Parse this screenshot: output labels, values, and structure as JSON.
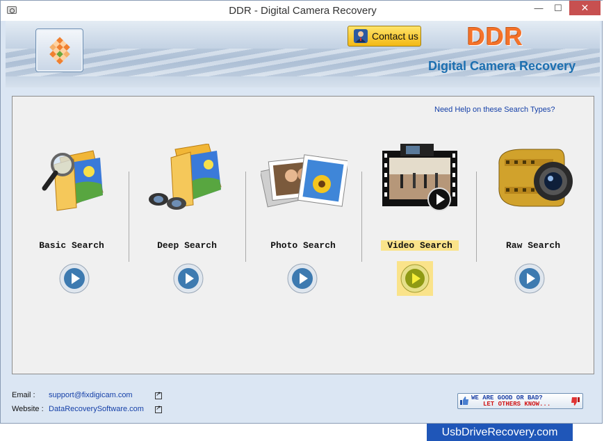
{
  "window": {
    "title": "DDR - Digital Camera Recovery",
    "minimize": "—",
    "maximize": "☐",
    "close": "✕"
  },
  "header": {
    "contact_label": "Contact us",
    "brand": "DDR",
    "subtitle": "Digital Camera Recovery"
  },
  "panel": {
    "help_link": "Need Help on these Search Types?",
    "options": [
      {
        "label": "Basic Search",
        "selected": false
      },
      {
        "label": "Deep Search",
        "selected": false
      },
      {
        "label": "Photo Search",
        "selected": false
      },
      {
        "label": "Video Search",
        "selected": true
      },
      {
        "label": "Raw Search",
        "selected": false
      }
    ]
  },
  "footer": {
    "email_label": "Email :",
    "email": "support@fixdigicam.com",
    "website_label": "Website :",
    "website": "DataRecoverySoftware.com",
    "rating_line1": "WE ARE GOOD OR BAD?",
    "rating_line2": "LET OTHERS KNOW..."
  },
  "banner": "UsbDriveRecovery.com",
  "colors": {
    "accent_orange": "#f4722a",
    "subtitle_blue": "#1c6fb0",
    "selection": "#fae38a",
    "link": "#1540a8"
  }
}
